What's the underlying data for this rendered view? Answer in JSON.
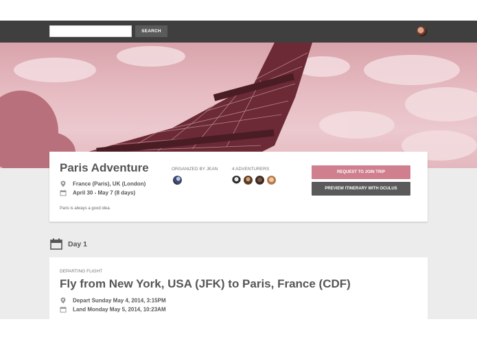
{
  "search": {
    "placeholder": "",
    "button_label": "SEARCH"
  },
  "nav": {
    "avatar_icon": "user-avatar"
  },
  "trip": {
    "title": "Paris Adventure",
    "location": "France (Paris), UK (London)",
    "dates": "April 30 - May 7 (8 days)",
    "tagline": "Paris is always a good idea.",
    "organizer_label": "ORGANIZED BY JEAN",
    "adventurers_label": "4 ADVENTURERS",
    "join_button": "REQUEST TO JOIN TRIP",
    "preview_button": "PREVIEW ITINERARY WITH OCULUS"
  },
  "itinerary": {
    "day_label": "Day 1",
    "flight": {
      "type_label": "DEPARTING FLIGHT",
      "title": "Fly from New York, USA (JFK) to Paris, France (CDF)",
      "depart": "Depart Sunday May 4, 2014, 3:15PM",
      "land": "Land Monday May 5, 2014, 10:23AM"
    }
  },
  "colors": {
    "accent": "#cf7f8e",
    "navbar": "#3f3f3f",
    "dark_button": "#5a5a5a"
  }
}
